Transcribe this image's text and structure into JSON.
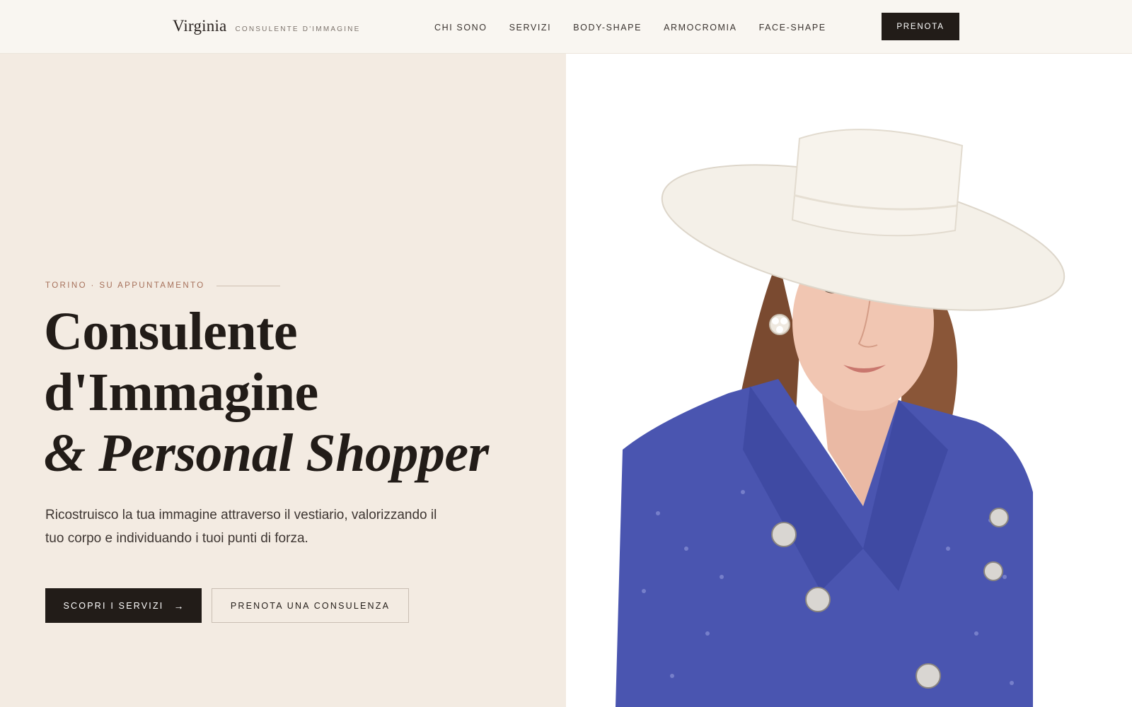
{
  "header": {
    "brand_name": "Virginia",
    "brand_tagline": "CONSULENTE D'IMMAGINE",
    "nav": [
      "CHI SONO",
      "SERVIZI",
      "BODY-SHAPE",
      "ARMOCROMIA",
      "FACE-SHAPE"
    ],
    "cta_label": "PRENOTA"
  },
  "hero": {
    "eyebrow": "TORINO · SU APPUNTAMENTO",
    "title_line1": "Consulente",
    "title_line2": "d'Immagine",
    "title_line3": "& Personal Shopper",
    "description": "Ricostruisco la tua immagine attraverso il vestiario, valorizzando il tuo corpo e individuando i tuoi punti di forza.",
    "primary_button": "SCOPRI I SERVIZI",
    "primary_button_arrow": "→",
    "secondary_button": "PRENOTA UNA CONSULENZA"
  },
  "photo": {
    "subject": "portrait-woman-white-hat-blue-tweed-jacket"
  },
  "colors": {
    "dark": "#221c18",
    "accent": "#a6705a",
    "panel_bg": "#f3ebe2",
    "header_bg": "#f9f6f1",
    "jacket_blue": "#4a55b0"
  }
}
